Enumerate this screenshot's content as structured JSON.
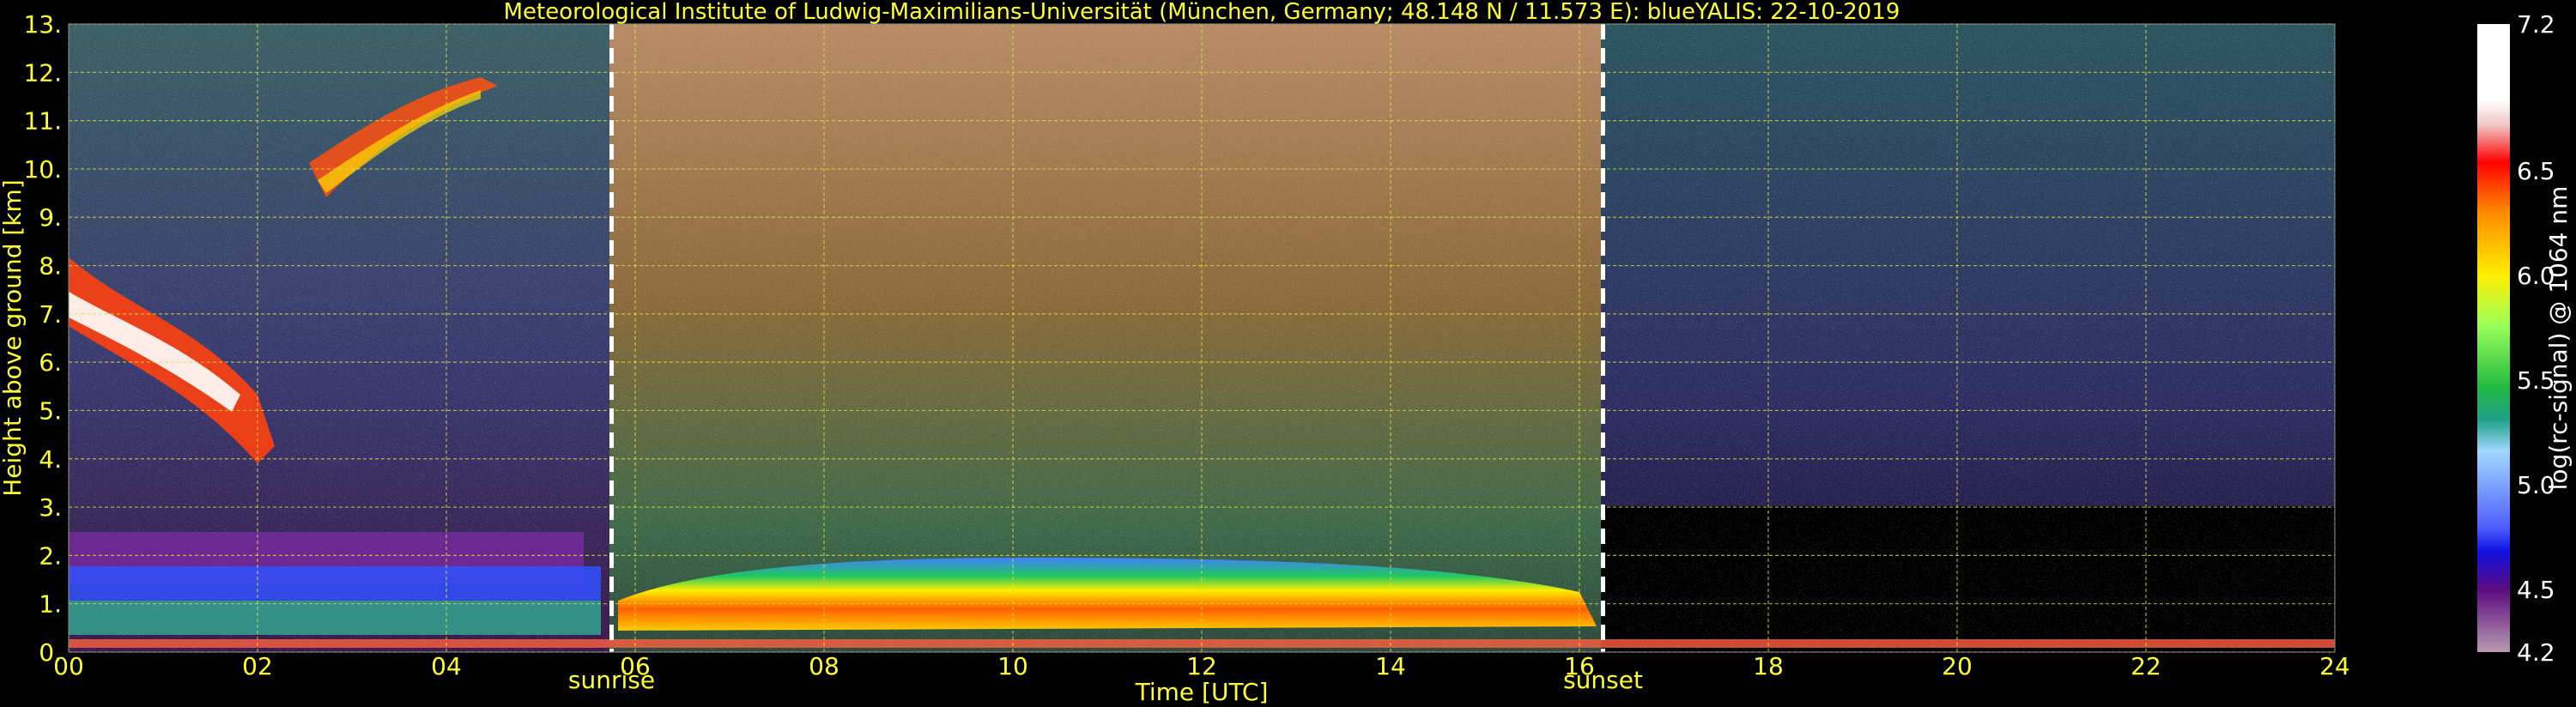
{
  "chart_data": {
    "type": "heatmap",
    "title": "Meteorological Institute of Ludwig-Maximilians-Universität (München, Germany; 48.148 N / 11.573 E):     blueYALIS: 22-10-2019",
    "xlabel": "Time [UTC]",
    "ylabel": "Height above ground [km]",
    "colorbar_label": "log(rc-signal) @ 1064 nm",
    "xlim": [
      0,
      24
    ],
    "ylim": [
      0,
      13
    ],
    "x_ticks": [
      "00",
      "02",
      "04",
      "06",
      "08",
      "10",
      "12",
      "14",
      "16",
      "18",
      "20",
      "22",
      "24"
    ],
    "y_ticks": [
      "0.",
      "1.",
      "2.",
      "3.",
      "4.",
      "5.",
      "6.",
      "7.",
      "8.",
      "9.",
      "10.",
      "11.",
      "12.",
      "13."
    ],
    "colorbar_range": [
      4.2,
      7.2
    ],
    "colorbar_ticks": [
      "7.2",
      "6.5",
      "6.0",
      "5.5",
      "5.0",
      "4.5",
      "4.2"
    ],
    "grid": true,
    "annotations": [
      {
        "label": "sunrise",
        "x": 5.75
      },
      {
        "label": "sunset",
        "x": 16.25
      }
    ],
    "colors": {
      "text": "#ffff33",
      "grid": "#e0e040",
      "marker_line": "#ffffff"
    }
  }
}
